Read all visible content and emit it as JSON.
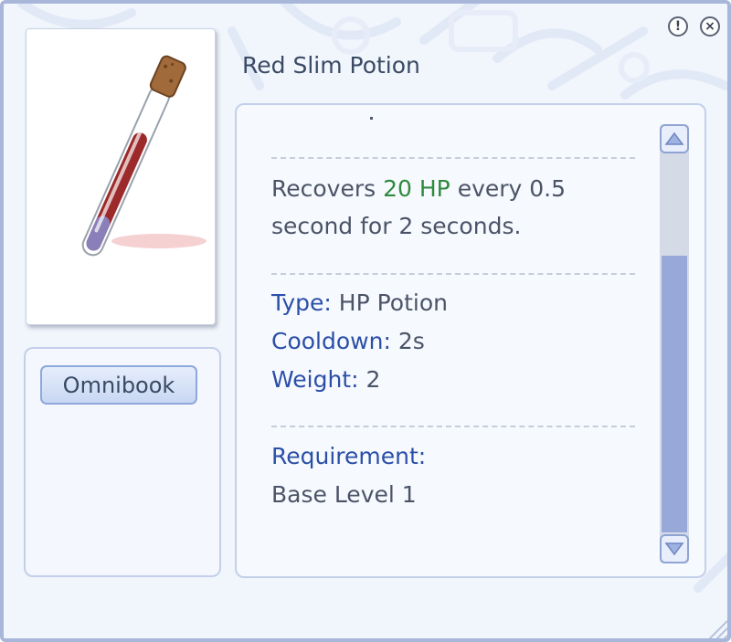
{
  "window": {
    "info_glyph": "!",
    "close_glyph": "×"
  },
  "item": {
    "name": "Red Slim Potion",
    "image_icon": "red-slim-potion-icon"
  },
  "omnibook": {
    "label": "Omnibook"
  },
  "description": {
    "effect_prefix": "Recovers ",
    "effect_highlight": "20 HP",
    "effect_suffix": " every 0.5",
    "effect_line2": "second for 2 seconds.",
    "type_label": "Type:",
    "type_value": " HP Potion",
    "cooldown_label": "Cooldown:",
    "cooldown_value": " 2s",
    "weight_label": "Weight:",
    "weight_value": " 2",
    "requirement_label": "Requirement:",
    "requirement_value": "Base Level 1"
  },
  "colors": {
    "label_blue": "#2b4fa8",
    "highlight_green": "#2e8a3e",
    "body_text": "#4b5467",
    "frame": "#a8b7d9"
  },
  "scrollbar": {
    "position_fraction": 1.0
  }
}
